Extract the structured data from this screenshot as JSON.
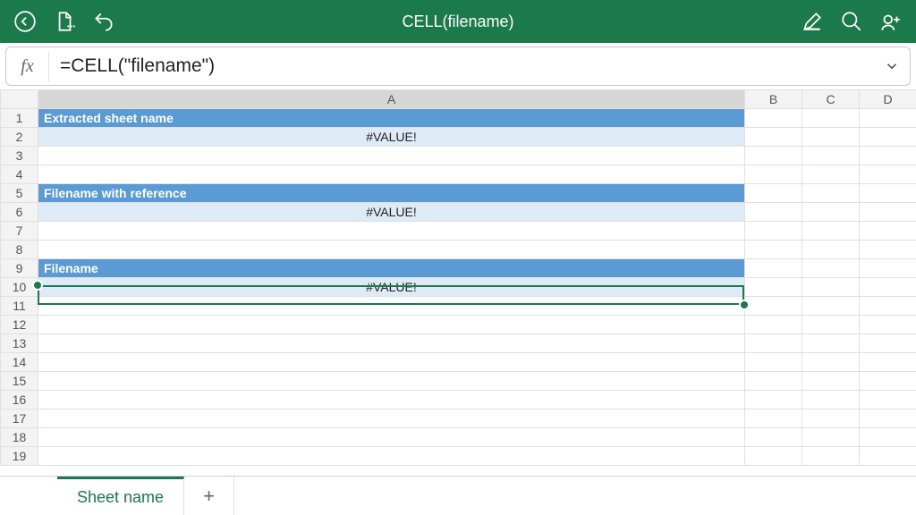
{
  "header": {
    "title": "CELL(filename)"
  },
  "formula_bar": {
    "fx_label": "fx",
    "formula": "=CELL(\"filename\")"
  },
  "columns": [
    "A",
    "B",
    "C",
    "D"
  ],
  "rows": [
    "1",
    "2",
    "3",
    "4",
    "5",
    "6",
    "7",
    "8",
    "9",
    "10",
    "11",
    "12",
    "13",
    "14",
    "15",
    "16",
    "17",
    "18",
    "19"
  ],
  "cells": {
    "A1": "Extracted sheet name",
    "A2": "#VALUE!",
    "A5": "Filename with reference",
    "A6": "#VALUE!",
    "A9": "Filename",
    "A10": "#VALUE!"
  },
  "selected_cell": "A10",
  "sheet_tabs": {
    "active": "Sheet name",
    "add_label": "+"
  }
}
